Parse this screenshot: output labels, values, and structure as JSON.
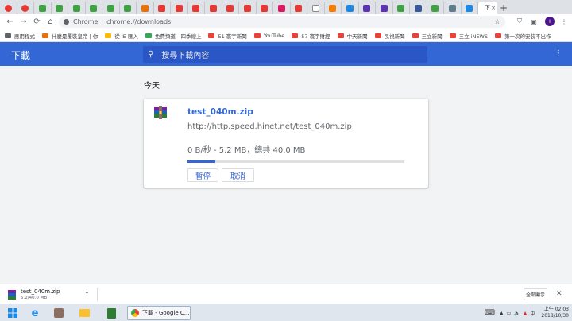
{
  "browser": {
    "active_tab_title": "下",
    "new_tab_label": "+",
    "omnibox": {
      "chip": "Chrome",
      "separator": "|",
      "url": "chrome://downloads"
    },
    "bookmarks": [
      {
        "label": "應用程式",
        "color": "#5f6368"
      },
      {
        "label": "什麼是覆裝皇帝 | 你",
        "color": "#e8710a"
      },
      {
        "label": "從 IE 匯入",
        "color": "#fbbc04"
      },
      {
        "label": "免費頻道 - 四季線上",
        "color": "#34a853"
      },
      {
        "label": "51 寰宇新聞",
        "color": "#ea4335"
      },
      {
        "label": "YouTube",
        "color": "#ea4335"
      },
      {
        "label": "57 寰宇財經",
        "color": "#ea4335"
      },
      {
        "label": "中天新聞",
        "color": "#ea4335"
      },
      {
        "label": "民視新聞",
        "color": "#ea4335"
      },
      {
        "label": "三立新聞",
        "color": "#ea4335"
      },
      {
        "label": "三立 iNEWS",
        "color": "#ea4335"
      },
      {
        "label": "第一次的安裝不出作",
        "color": "#ea4335"
      }
    ]
  },
  "downloads": {
    "title": "下載",
    "search_placeholder": "搜尋下載內容",
    "section_label": "今天",
    "item": {
      "filename": "test_040m.zip",
      "url": "http://http.speed.hinet.net/test_040m.zip",
      "status": "0 B/秒 - 5.2 MB，總共 40.0 MB",
      "progress_fraction": 0.13,
      "pause_label": "暫停",
      "cancel_label": "取消"
    }
  },
  "shelf": {
    "filename": "test_040m.zip",
    "size": "5.2/40.0 MB",
    "show_all_label": "全部顯示"
  },
  "taskbar": {
    "chrome_label": "下載 - Google C...",
    "time": "上午 02:03",
    "date": "2018/10/30"
  },
  "colors": {
    "header_blue": "#3367d6",
    "link_blue": "#3367d6"
  }
}
